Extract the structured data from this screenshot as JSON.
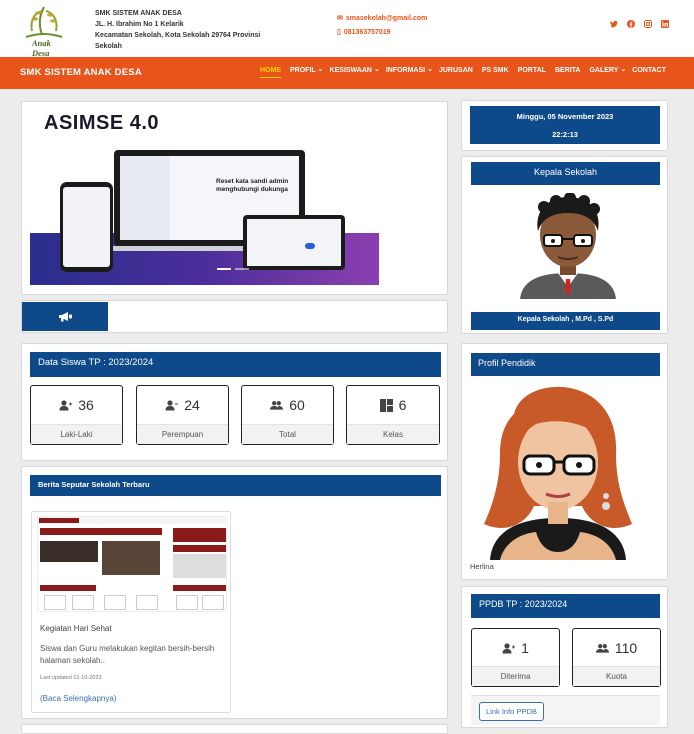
{
  "school": {
    "name": "SMK SISTEM ANAK DESA",
    "address_line1": "JL. H. Ibrahim No 1 Kelarik",
    "address_line2": "Kecamatan Sekolah, Kota Sekolah 29764 Provinsi Sekolah",
    "logo_text": "Anak Desa"
  },
  "contact": {
    "email": "smasekolah@gmail.com",
    "phone": "081363757019"
  },
  "socials": [
    "twitter-icon",
    "facebook-icon",
    "instagram-icon",
    "linkedin-icon"
  ],
  "nav": {
    "brand": "SMK SISTEM ANAK DESA",
    "items": [
      {
        "label": "HOME",
        "dropdown": false
      },
      {
        "label": "PROFIL",
        "dropdown": true
      },
      {
        "label": "KESISWAAN",
        "dropdown": true
      },
      {
        "label": "INFORMASI",
        "dropdown": true
      },
      {
        "label": "JURUSAN",
        "dropdown": false
      },
      {
        "label": "PS SMK",
        "dropdown": false
      },
      {
        "label": "PORTAL",
        "dropdown": false
      },
      {
        "label": "BERITA",
        "dropdown": false
      },
      {
        "label": "GALERY",
        "dropdown": true
      },
      {
        "label": "CONTACT",
        "dropdown": false
      }
    ]
  },
  "slider": {
    "title": "ASIMSE 4.0",
    "screen_text1": "Reset kata sandi admin",
    "screen_text2": "menghubungi dukunga"
  },
  "datetime": {
    "date": "Minggu, 05 November 2023",
    "time": "22:2:13"
  },
  "kepala": {
    "title": "Kepala Sekolah",
    "name": "Kepala Sekolah , M.Pd , S.Pd"
  },
  "data_siswa": {
    "title": "Data Siswa TP : 2023/2024",
    "stats": [
      {
        "value": "36",
        "label": "Laki-Laki",
        "icon": "user-plus-icon"
      },
      {
        "value": "24",
        "label": "Perempuan",
        "icon": "user-minus-icon"
      },
      {
        "value": "60",
        "label": "Total",
        "icon": "users-icon"
      },
      {
        "value": "6",
        "label": "Kelas",
        "icon": "grid-icon"
      }
    ]
  },
  "berita": {
    "title": "Berita Seputar Sekolah Terbaru",
    "post_title": "Kegiatan Hari Sehat",
    "excerpt": "Siswa dan Guru melakukan kegitan bersih-bersih halaman sekolah..",
    "updated": "Last updated 01-10-2023",
    "read_more": "(Baca Selengkapnya)"
  },
  "pendidik": {
    "title": "Profil Pendidik",
    "name": "Herlina"
  },
  "ppdb": {
    "title": "PPDB TP : 2023/2024",
    "stats": [
      {
        "value": "1",
        "label": "Diterima",
        "icon": "user-plus-icon"
      },
      {
        "value": "110",
        "label": "Kuota",
        "icon": "users-icon"
      }
    ],
    "link": "Link Info PPDB"
  },
  "colors": {
    "accent": "#e8541a",
    "blue": "#0e4a8a",
    "active_nav": "#ffd400"
  }
}
